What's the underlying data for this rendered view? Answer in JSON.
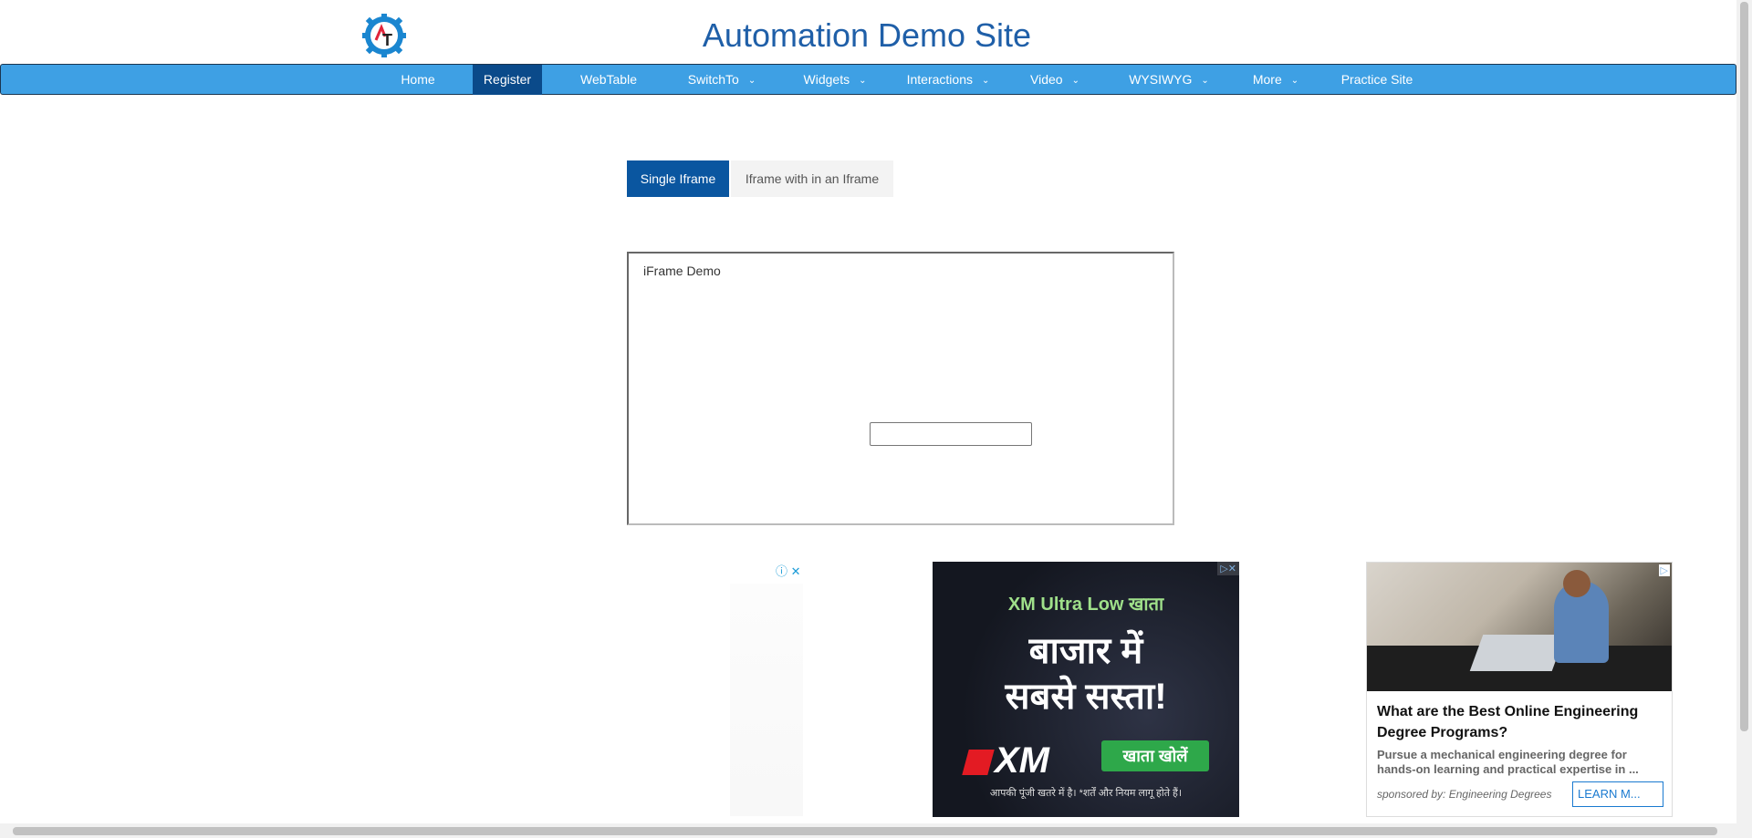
{
  "header": {
    "title": "Automation Demo Site",
    "logo_icon": "gear-logo-icon"
  },
  "nav": {
    "items": [
      {
        "label": "Home",
        "dropdown": false
      },
      {
        "label": "Register",
        "dropdown": false,
        "active": true
      },
      {
        "label": "WebTable",
        "dropdown": false
      },
      {
        "label": "SwitchTo",
        "dropdown": true
      },
      {
        "label": "Widgets",
        "dropdown": true
      },
      {
        "label": "Interactions",
        "dropdown": true
      },
      {
        "label": "Video",
        "dropdown": true
      },
      {
        "label": "WYSIWYG",
        "dropdown": true
      },
      {
        "label": "More",
        "dropdown": true
      },
      {
        "label": "Practice Site",
        "dropdown": false
      }
    ],
    "chevron": "⌄"
  },
  "tabs": {
    "single": "Single Iframe",
    "nested": "Iframe with in an Iframe"
  },
  "iframe": {
    "label": "iFrame Demo",
    "input_value": ""
  },
  "ads": {
    "controls": "ⓘ ✕",
    "xm": {
      "line1": "XM Ultra Low खाता",
      "line2": "बाजार में",
      "line3": "सबसे सस्ता!",
      "brand": "XM",
      "cta": "खाता खोलें",
      "footer": "आपकी पूंजी खतरे में है। *शर्तें और नियम लागू होते हैं।",
      "corner": "▷✕"
    },
    "engineering": {
      "headline": "What are the Best Online Engineering Degree Programs?",
      "description": "Pursue a mechanical engineering degree for hands-on learning and practical expertise in ...",
      "sponsor": "sponsored by: Engineering Degrees",
      "cta": "LEARN M...",
      "corner": "▷"
    }
  },
  "colors": {
    "nav_bg": "#3ea0e4",
    "nav_active": "#0a4a8a",
    "title": "#1f5fa8",
    "tab_active": "#0a56a0"
  }
}
